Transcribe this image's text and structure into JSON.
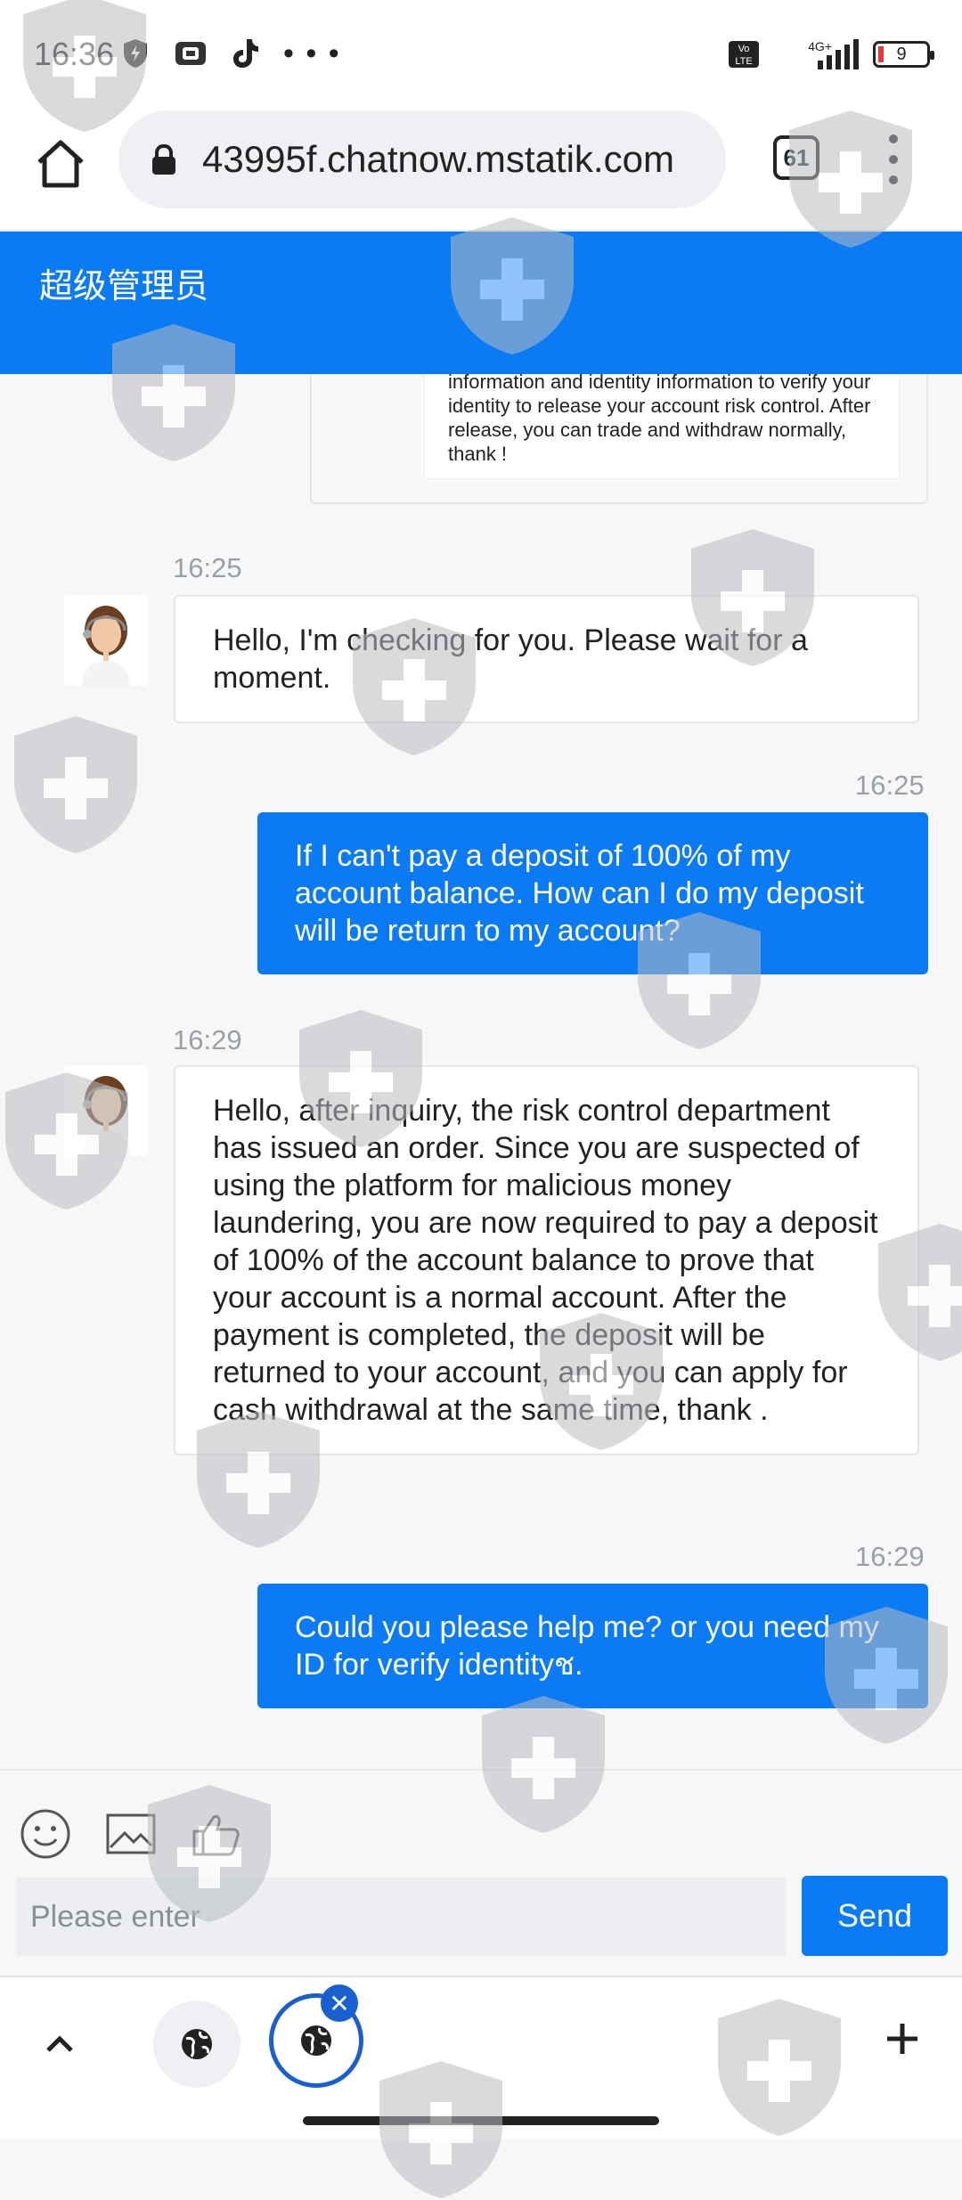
{
  "status_bar": {
    "time": "16:36",
    "network_label": "4G+",
    "volte_label": "Vo LTE",
    "battery_level": "9",
    "left_icons": [
      "shield-bolt-icon",
      "wallet-icon",
      "tiktok-icon",
      "more-dots-icon"
    ]
  },
  "browser": {
    "url": "43995f.chatnow.mstatik.com",
    "tab_count": "61"
  },
  "app": {
    "title": "超级管理员"
  },
  "chat": {
    "previous_message_tail": "information and identity information to verify your identity to release your account risk control. After release, you can trade and withdraw normally, thank !",
    "messages": [
      {
        "direction": "incoming",
        "time": "16:25",
        "text": "Hello, I'm checking for you. Please wait for a moment."
      },
      {
        "direction": "outgoing",
        "time": "16:25",
        "text": "If I can't pay a deposit of 100% of my account balance. How can I do my deposit will be return to my account?"
      },
      {
        "direction": "incoming",
        "time": "16:29",
        "text": "Hello, after inquiry, the risk control department has issued an order. Since you are suspected of using the platform for malicious money laundering, you are now required to pay a deposit of 100% of the account balance to prove that your account is a normal account. After the payment is completed, the deposit will be returned to your account, and you can apply for cash withdrawal at the same time, thank ."
      },
      {
        "direction": "outgoing",
        "time": "16:29",
        "text": "Could you please help me? or you need my ID for verify identityช."
      }
    ]
  },
  "composer": {
    "placeholder": "Please enter",
    "send_label": "Send",
    "tools": [
      "emoji-icon",
      "image-icon",
      "thumbs-up-icon"
    ]
  },
  "colors": {
    "brand_blue": "#0a7bf4",
    "tab_active_blue": "#1a5fd0"
  }
}
